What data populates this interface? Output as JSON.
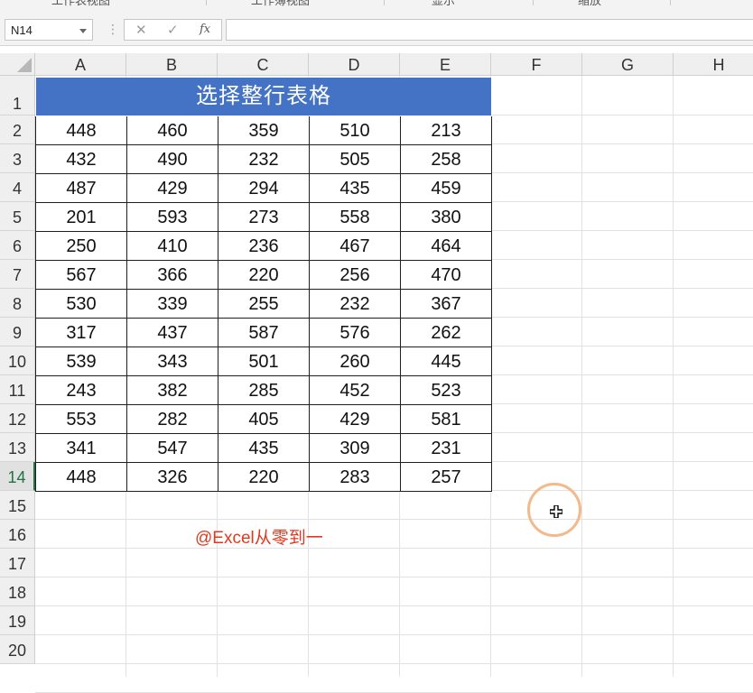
{
  "ribbon": {
    "labels": [
      "工作表视图",
      "工作簿视图",
      "显示",
      "缩放"
    ]
  },
  "formula_bar": {
    "name_box": "N14",
    "cancel_icon": "✕",
    "enter_icon": "✓",
    "fx_label": "fx",
    "formula_value": ""
  },
  "columns": [
    "A",
    "B",
    "C",
    "D",
    "E",
    "F",
    "G",
    "H"
  ],
  "rows": [
    "1",
    "2",
    "3",
    "4",
    "5",
    "6",
    "7",
    "8",
    "9",
    "10",
    "11",
    "12",
    "13",
    "14",
    "15",
    "16",
    "17",
    "18",
    "19",
    "20"
  ],
  "active_row": "14",
  "table": {
    "title": "选择整行表格",
    "data": [
      [
        "448",
        "460",
        "359",
        "510",
        "213"
      ],
      [
        "432",
        "490",
        "232",
        "505",
        "258"
      ],
      [
        "487",
        "429",
        "294",
        "435",
        "459"
      ],
      [
        "201",
        "593",
        "273",
        "558",
        "380"
      ],
      [
        "250",
        "410",
        "236",
        "467",
        "464"
      ],
      [
        "567",
        "366",
        "220",
        "256",
        "470"
      ],
      [
        "530",
        "339",
        "255",
        "232",
        "367"
      ],
      [
        "317",
        "437",
        "587",
        "576",
        "262"
      ],
      [
        "539",
        "343",
        "501",
        "260",
        "445"
      ],
      [
        "243",
        "382",
        "285",
        "452",
        "523"
      ],
      [
        "553",
        "282",
        "405",
        "429",
        "581"
      ],
      [
        "341",
        "547",
        "435",
        "309",
        "231"
      ],
      [
        "448",
        "326",
        "220",
        "283",
        "257"
      ]
    ]
  },
  "watermark": "@Excel从零到一",
  "colors": {
    "title_bg": "#4472c4",
    "watermark": "#e0391f",
    "cursor_ring": "#f3b98a",
    "active_row_accent": "#217346"
  }
}
